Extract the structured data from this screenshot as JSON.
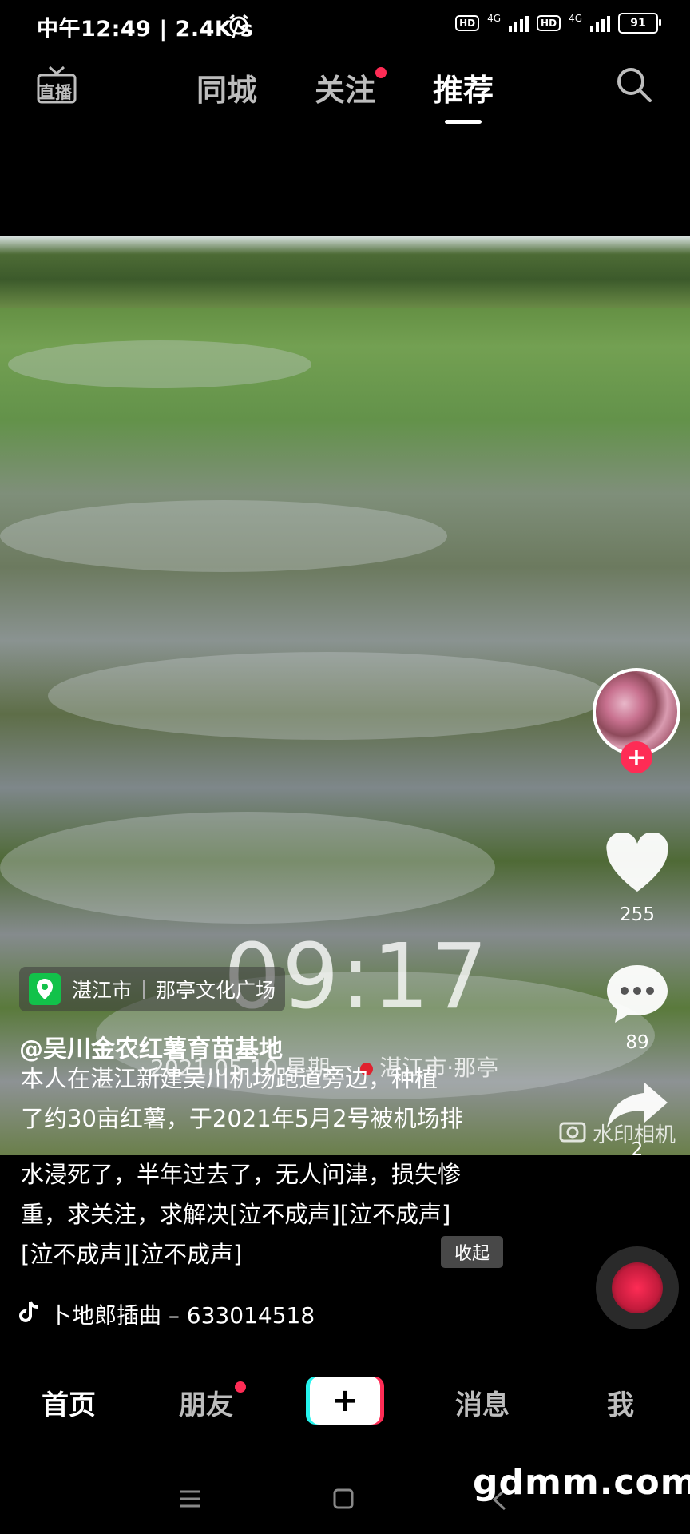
{
  "status_bar": {
    "time": "中午12:49 | 2.4K/s",
    "hd1": "HD",
    "net1": "4G",
    "hd2": "HD",
    "net2": "4G",
    "battery": "91"
  },
  "top_nav": {
    "live": "直播",
    "tabs": [
      {
        "label": "同城"
      },
      {
        "label": "关注"
      },
      {
        "label": "推荐"
      }
    ],
    "active_tab": "推荐"
  },
  "video": {
    "clock_overlay": "09:17",
    "date_overlay": "2021.05.10 星期一",
    "date_location": "湛江市·那亭",
    "watermark": "水印相机"
  },
  "location": {
    "city": "湛江市",
    "place": "那亭文化广场"
  },
  "post": {
    "author": "@吴川金农红薯育苗基地",
    "desc_lines": [
      "本人在湛江新建吴川机场跑道旁边，种植",
      "了约30亩红薯，于2021年5月2号被机场排",
      "水浸死了，半年过去了，无人问津，损失惨",
      "重，求关注，求解决[泣不成声][泣不成声]",
      "[泣不成声][泣不成声]"
    ],
    "collapse": "收起",
    "music": "卜地郎插曲 – 633014518"
  },
  "actions": {
    "likes": "255",
    "comments": "89",
    "shares": "2"
  },
  "bottom_nav": {
    "items": [
      {
        "label": "首页"
      },
      {
        "label": "朋友"
      },
      {
        "label": "消息"
      },
      {
        "label": "我"
      }
    ],
    "active": "首页"
  },
  "watermark_site": "gdmm.com",
  "colors": {
    "accent_red": "#fe2c55",
    "accent_cyan": "#25f4ee",
    "location_green": "#12c24a"
  }
}
